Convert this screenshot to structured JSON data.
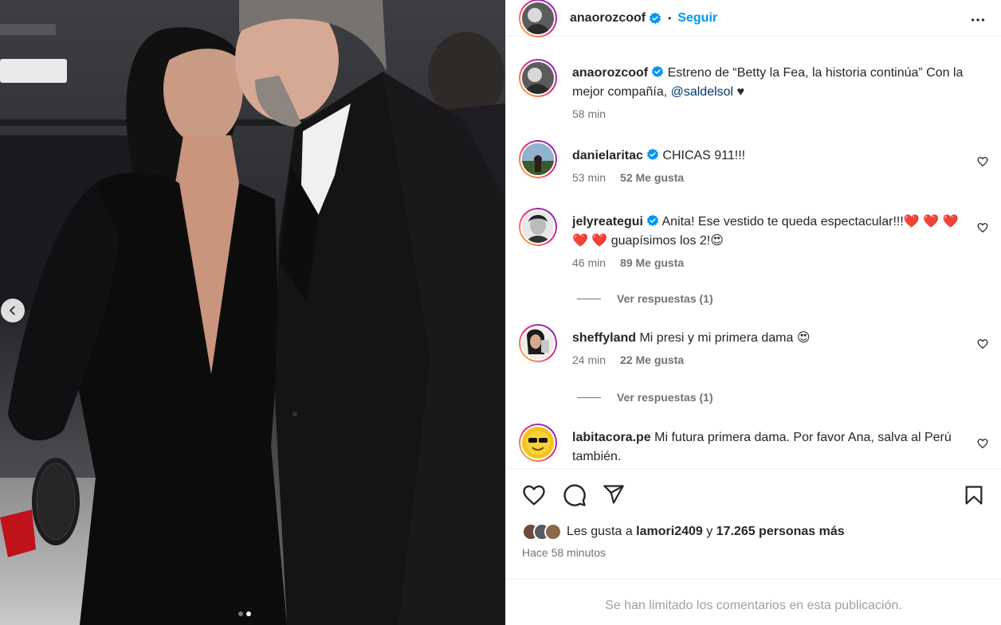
{
  "post": {
    "author": "anaorozcoof",
    "follow_label": "Seguir",
    "separator": "•",
    "caption_text": " Estreno de “Betty la Fea, la historia continúa” Con la mejor compañía, ",
    "caption_mention": "@saldelsol",
    "caption_end": " ♥",
    "caption_time": "58 min"
  },
  "comments": [
    {
      "user": "danielaritac",
      "text": " CHICAS 911!!!",
      "time": "53 min",
      "likes": "52 Me gusta"
    },
    {
      "user": "jelyreategui",
      "text": " Anita! Ese vestido te queda espectacular!!!❤️ ❤️ ❤️ ❤️ ❤️ guapísimos los 2!😍",
      "time": "46 min",
      "likes": "89 Me gusta",
      "replies": "Ver respuestas (1)"
    },
    {
      "user": "sheffyland",
      "text": " Mi presi y mi primera dama 😍",
      "time": "24 min",
      "likes": "22 Me gusta",
      "replies": "Ver respuestas (1)"
    },
    {
      "user": "labitacora.pe",
      "text": " Mi futura primera dama. Por favor Ana, salva al Perú también."
    }
  ],
  "likes": {
    "prefix": "Les gusta a ",
    "user": "lamori2409",
    "connector": " y ",
    "count": "17.265 personas más"
  },
  "timestamp": "Hace 58 minutos",
  "comments_limited": "Se han limitado los comentarios en esta publicación.",
  "carousel": {
    "total": 2,
    "active": 2
  },
  "colors": {
    "follow": "#0095f6",
    "mention": "#00376b",
    "verified": "#0095f6",
    "muted": "#737373"
  },
  "icons": [
    "more-icon",
    "heart-icon",
    "comment-icon",
    "share-icon",
    "bookmark-icon",
    "chevron-left-icon",
    "verified-icon"
  ]
}
